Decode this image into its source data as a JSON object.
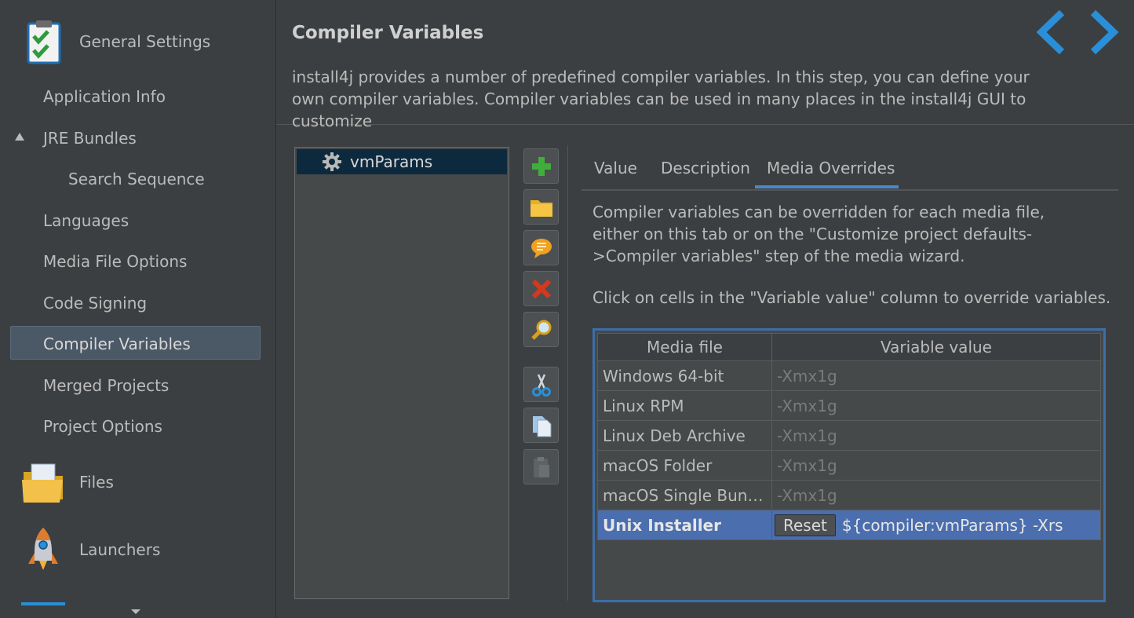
{
  "sidebar": {
    "sections": [
      {
        "label": "General Settings",
        "icon": "clipboard-check-icon"
      },
      {
        "label": "Files",
        "icon": "folder-icon"
      },
      {
        "label": "Launchers",
        "icon": "rocket-icon"
      }
    ],
    "items": [
      {
        "label": "Application Info"
      },
      {
        "label": "JRE Bundles"
      },
      {
        "label": "Search Sequence"
      },
      {
        "label": "Languages"
      },
      {
        "label": "Media File Options"
      },
      {
        "label": "Code Signing"
      },
      {
        "label": "Compiler Variables"
      },
      {
        "label": "Merged Projects"
      },
      {
        "label": "Project Options"
      }
    ],
    "selected": "Compiler Variables"
  },
  "header": {
    "title": "Compiler Variables",
    "description": "install4j provides a number of predefined compiler variables. In this step, you can define your own compiler variables. Compiler variables can be used in many places in the install4j GUI to customize",
    "nav_back_icon": "chevron-left-icon",
    "nav_forward_icon": "chevron-right-icon"
  },
  "variables": [
    {
      "name": "vmParams",
      "icon": "gear-icon"
    }
  ],
  "toolbar": [
    {
      "name": "add-variable-button",
      "icon": "plus-icon"
    },
    {
      "name": "add-folder-button",
      "icon": "folder-icon"
    },
    {
      "name": "edit-comment-button",
      "icon": "comment-icon"
    },
    {
      "name": "delete-button",
      "icon": "close-icon"
    },
    {
      "name": "search-button",
      "icon": "magnifier-icon"
    },
    {
      "name": "cut-button",
      "icon": "scissors-icon"
    },
    {
      "name": "copy-button",
      "icon": "copy-icon"
    },
    {
      "name": "paste-button",
      "icon": "paste-icon"
    }
  ],
  "tabs": [
    {
      "label": "Value"
    },
    {
      "label": "Description"
    },
    {
      "label": "Media Overrides"
    }
  ],
  "active_tab": "Media Overrides",
  "overrides": {
    "info": "Compiler variables can be overridden for each media file, either on this tab or on the \"Customize project defaults->Compiler variables\" step of the media wizard.",
    "hint": "Click on cells in the \"Variable value\" column to override variables.",
    "columns": [
      "Media file",
      "Variable value"
    ],
    "rows": [
      {
        "media": "Windows 64-bit",
        "value": "-Xmx1g"
      },
      {
        "media": "Linux RPM",
        "value": "-Xmx1g"
      },
      {
        "media": "Linux Deb Archive",
        "value": "-Xmx1g"
      },
      {
        "media": "macOS Folder",
        "value": "-Xmx1g"
      },
      {
        "media": "macOS Single Bundl...",
        "value": "-Xmx1g"
      }
    ],
    "selected_row": {
      "media": "Unix Installer",
      "reset_label": "Reset",
      "value": "${compiler:vmParams} -Xrs"
    }
  },
  "colors": {
    "accent": "#4a88c7",
    "selection": "#4b6eaf",
    "background": "#3c3f41"
  }
}
